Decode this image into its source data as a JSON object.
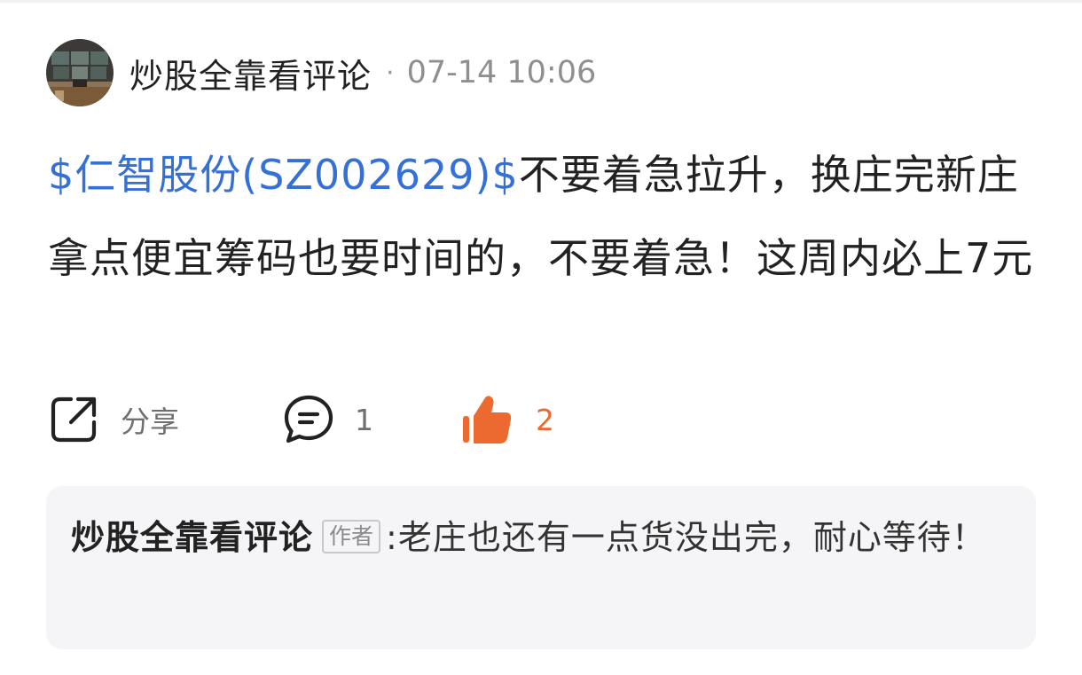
{
  "post": {
    "author": "炒股全靠看评论",
    "separator": "·",
    "timestamp": "07-14 10:06",
    "stock_link": "$仁智股份(SZ002629)$",
    "content": "不要着急拉升，换庄完新庄拿点便宜筹码也要时间的，不要着急！这周内必上7元"
  },
  "actions": {
    "share_icon": "share-icon",
    "share_label": "分享",
    "comment_icon": "comment-icon",
    "comment_count": "1",
    "like_icon": "thumbs-up-icon",
    "like_count": "2"
  },
  "reply": {
    "author": "炒股全靠看评论",
    "author_tag": "作者",
    "separator": ":",
    "text": "老庄也还有一点货没出完，耐心等待！"
  },
  "colors": {
    "link": "#3470d6",
    "like_active": "#ec6a2f",
    "card_bg": "#f5f5f7"
  }
}
